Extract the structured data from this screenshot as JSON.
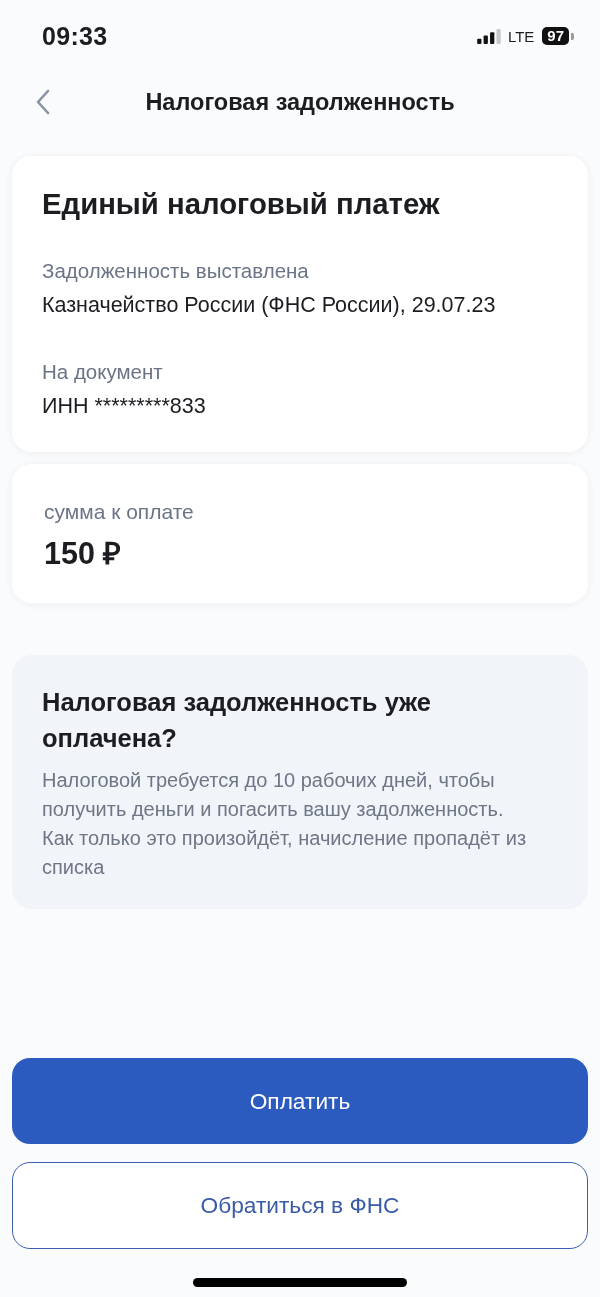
{
  "status_bar": {
    "time": "09:33",
    "network": "LTE",
    "battery": "97"
  },
  "nav": {
    "title": "Налоговая задолженность"
  },
  "debt_card": {
    "title": "Единый налоговый платеж",
    "fields": [
      {
        "label": "Задолженность выставлена",
        "value": "Казначейство России (ФНС России), 29.07.23"
      },
      {
        "label": "На документ",
        "value": "ИНН *********833"
      }
    ]
  },
  "amount_card": {
    "label": "сумма к оплате",
    "amount": "150 ₽"
  },
  "info_card": {
    "title": "Налоговая задолженность уже оплачена?",
    "text": "Налоговой требуется до 10 рабочих дней, чтобы получить деньги и погасить вашу задолженность. Как только это произойдёт, начисление пропадёт из списка"
  },
  "buttons": [
    {
      "kind": "primary",
      "label": "Оплатить"
    },
    {
      "kind": "outline",
      "label": "Обратиться в ФНС"
    }
  ]
}
